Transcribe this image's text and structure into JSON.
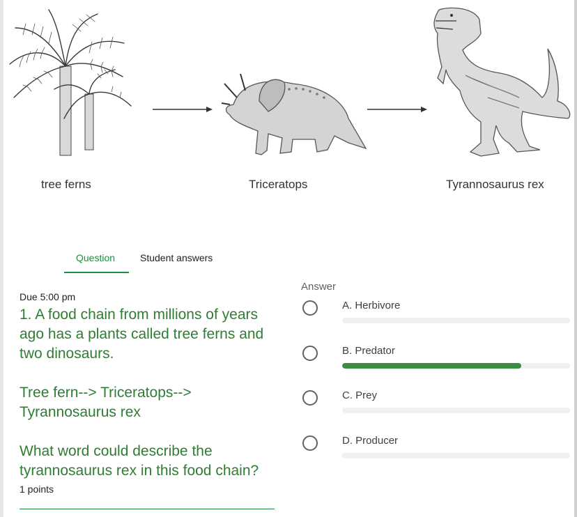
{
  "diagram": {
    "labels": [
      "tree ferns",
      "Triceratops",
      "Tyrannosaurus rex"
    ]
  },
  "tabs": {
    "question": "Question",
    "student_answers": "Student answers"
  },
  "question": {
    "due": "Due 5:00 pm",
    "paragraphs": [
      "1. A food chain from millions of years ago has a plants called tree ferns and two dinosaurs.",
      "Tree fern--> Triceratops--> Tyrannosaurus rex",
      "What word could describe the tyrannosaurus rex in this food chain?"
    ],
    "points": "1 points"
  },
  "answers": {
    "heading": "Answer",
    "options": [
      {
        "label": "A. Herbivore",
        "response_fraction": 0.0
      },
      {
        "label": "B. Predator",
        "response_fraction": 0.785
      },
      {
        "label": "C. Prey",
        "response_fraction": 0.0
      },
      {
        "label": "D. Producer",
        "response_fraction": 0.0
      }
    ]
  },
  "colors": {
    "accent_green": "#1e8e3e",
    "question_text": "#2e7d32",
    "bar_fill": "#3c8d40",
    "bar_track": "#eef0f2"
  }
}
